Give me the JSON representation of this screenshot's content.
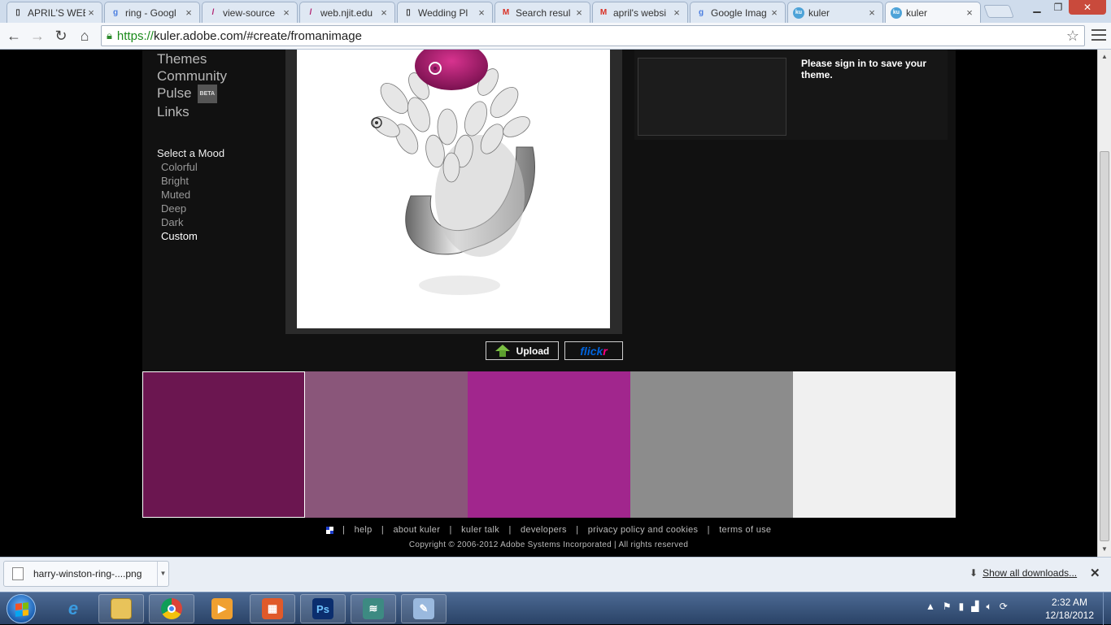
{
  "browser": {
    "tabs": [
      {
        "title": "APRIL'S WEB",
        "icon": "document-icon",
        "color": "#888888"
      },
      {
        "title": "ring - Googl",
        "icon": "google-icon",
        "color": "#4a7de0"
      },
      {
        "title": "view-source",
        "icon": "feather-icon",
        "color": "#b0186a"
      },
      {
        "title": "web.njit.edu",
        "icon": "feather-icon",
        "color": "#b0186a"
      },
      {
        "title": "Wedding Pl",
        "icon": "document-icon",
        "color": "#888888"
      },
      {
        "title": "Search resul",
        "icon": "gmail-icon",
        "color": "#d93025"
      },
      {
        "title": "april's websi",
        "icon": "gmail-icon",
        "color": "#d93025"
      },
      {
        "title": "Google Imag",
        "icon": "google-icon",
        "color": "#4a7de0"
      },
      {
        "title": "kuler",
        "icon": "kuler-icon",
        "color": "#4ea3d8"
      },
      {
        "title": "kuler",
        "icon": "kuler-icon",
        "color": "#4ea3d8"
      }
    ],
    "active_tab": 9,
    "url_scheme": "https://",
    "url_rest": "kuler.adobe.com/#create/fromanimage"
  },
  "nav": {
    "links": [
      "Themes",
      "Community",
      "Pulse",
      "Links"
    ],
    "beta_badge": "BETA",
    "mood_title": "Select a Mood",
    "moods": [
      "Colorful",
      "Bright",
      "Muted",
      "Deep",
      "Dark",
      "Custom"
    ],
    "selected_mood": "Custom"
  },
  "panel": {
    "signin_text": "Please sign in to save your theme."
  },
  "buttons": {
    "upload": "Upload",
    "flickr_a": "flick",
    "flickr_b": "r"
  },
  "palette": {
    "colors": [
      "#6b1650",
      "#8a567a",
      "#a1268d",
      "#8c8c8c",
      "#f0f0f0"
    ],
    "selected_index": 0
  },
  "footer": {
    "links": [
      "help",
      "about kuler",
      "kuler talk",
      "developers",
      "privacy policy and cookies",
      "terms of use"
    ],
    "copyright": "Copyright © 2006-2012 Adobe Systems Incorporated | All rights reserved"
  },
  "downloads": {
    "file": "harry-winston-ring-....png",
    "show_all": "Show all downloads..."
  },
  "taskbar": {
    "time": "2:32 AM",
    "date": "12/18/2012"
  }
}
